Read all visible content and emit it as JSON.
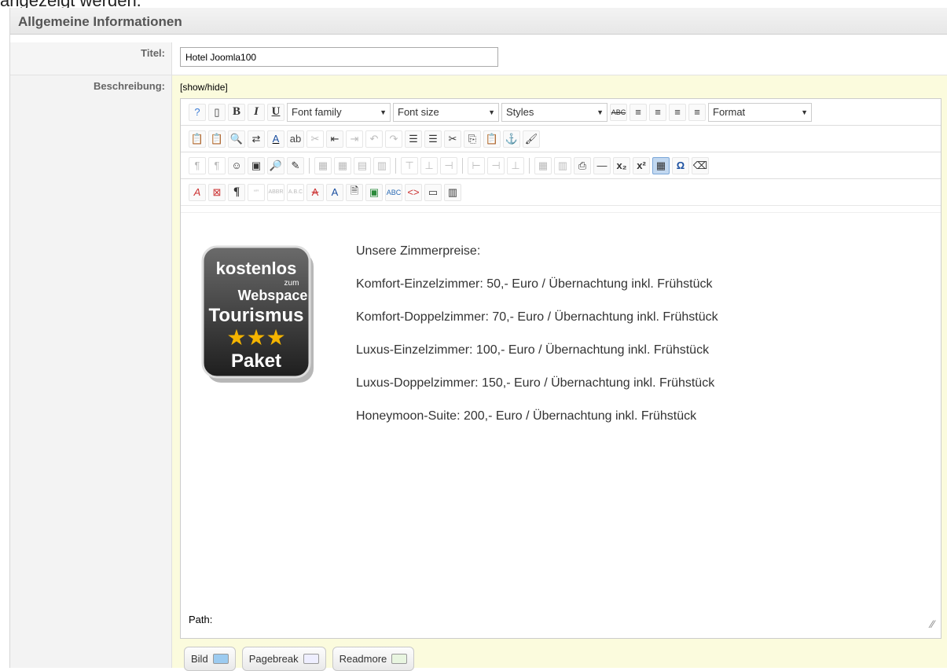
{
  "page": {
    "top_fragment": "angezeigt werden."
  },
  "section": {
    "legend": "Allgemeine Informationen"
  },
  "fields": {
    "title_label": "Titel:",
    "title_value": "Hotel Joomla100",
    "description_label": "Beschreibung:",
    "toggle_label": "[show/hide]"
  },
  "toolbar": {
    "font_family": "Font family",
    "font_size": "Font size",
    "styles": "Styles",
    "format": "Format"
  },
  "editor_content": {
    "lines": [
      "Unsere Zimmerpreise:",
      "Komfort-Einzelzimmer: 50,- Euro / Übernachtung inkl. Frühstück",
      "Komfort-Doppelzimmer: 70,- Euro / Übernachtung inkl. Frühstück",
      "Luxus-Einzelzimmer: 100,- Euro / Übernachtung inkl. Frühstück",
      "Luxus-Doppelzimmer: 150,- Euro / Übernachtung inkl. Frühstück",
      "Honeymoon-Suite: 200,- Euro / Übernachtung inkl. Frühstück"
    ],
    "logo_text": [
      "kostenlos",
      "zum",
      "Webspace",
      "Tourismus",
      "Paket"
    ]
  },
  "status": {
    "path_label": "Path:"
  },
  "buttons": {
    "image": "Bild",
    "pagebreak": "Pagebreak",
    "readmore": "Readmore"
  }
}
